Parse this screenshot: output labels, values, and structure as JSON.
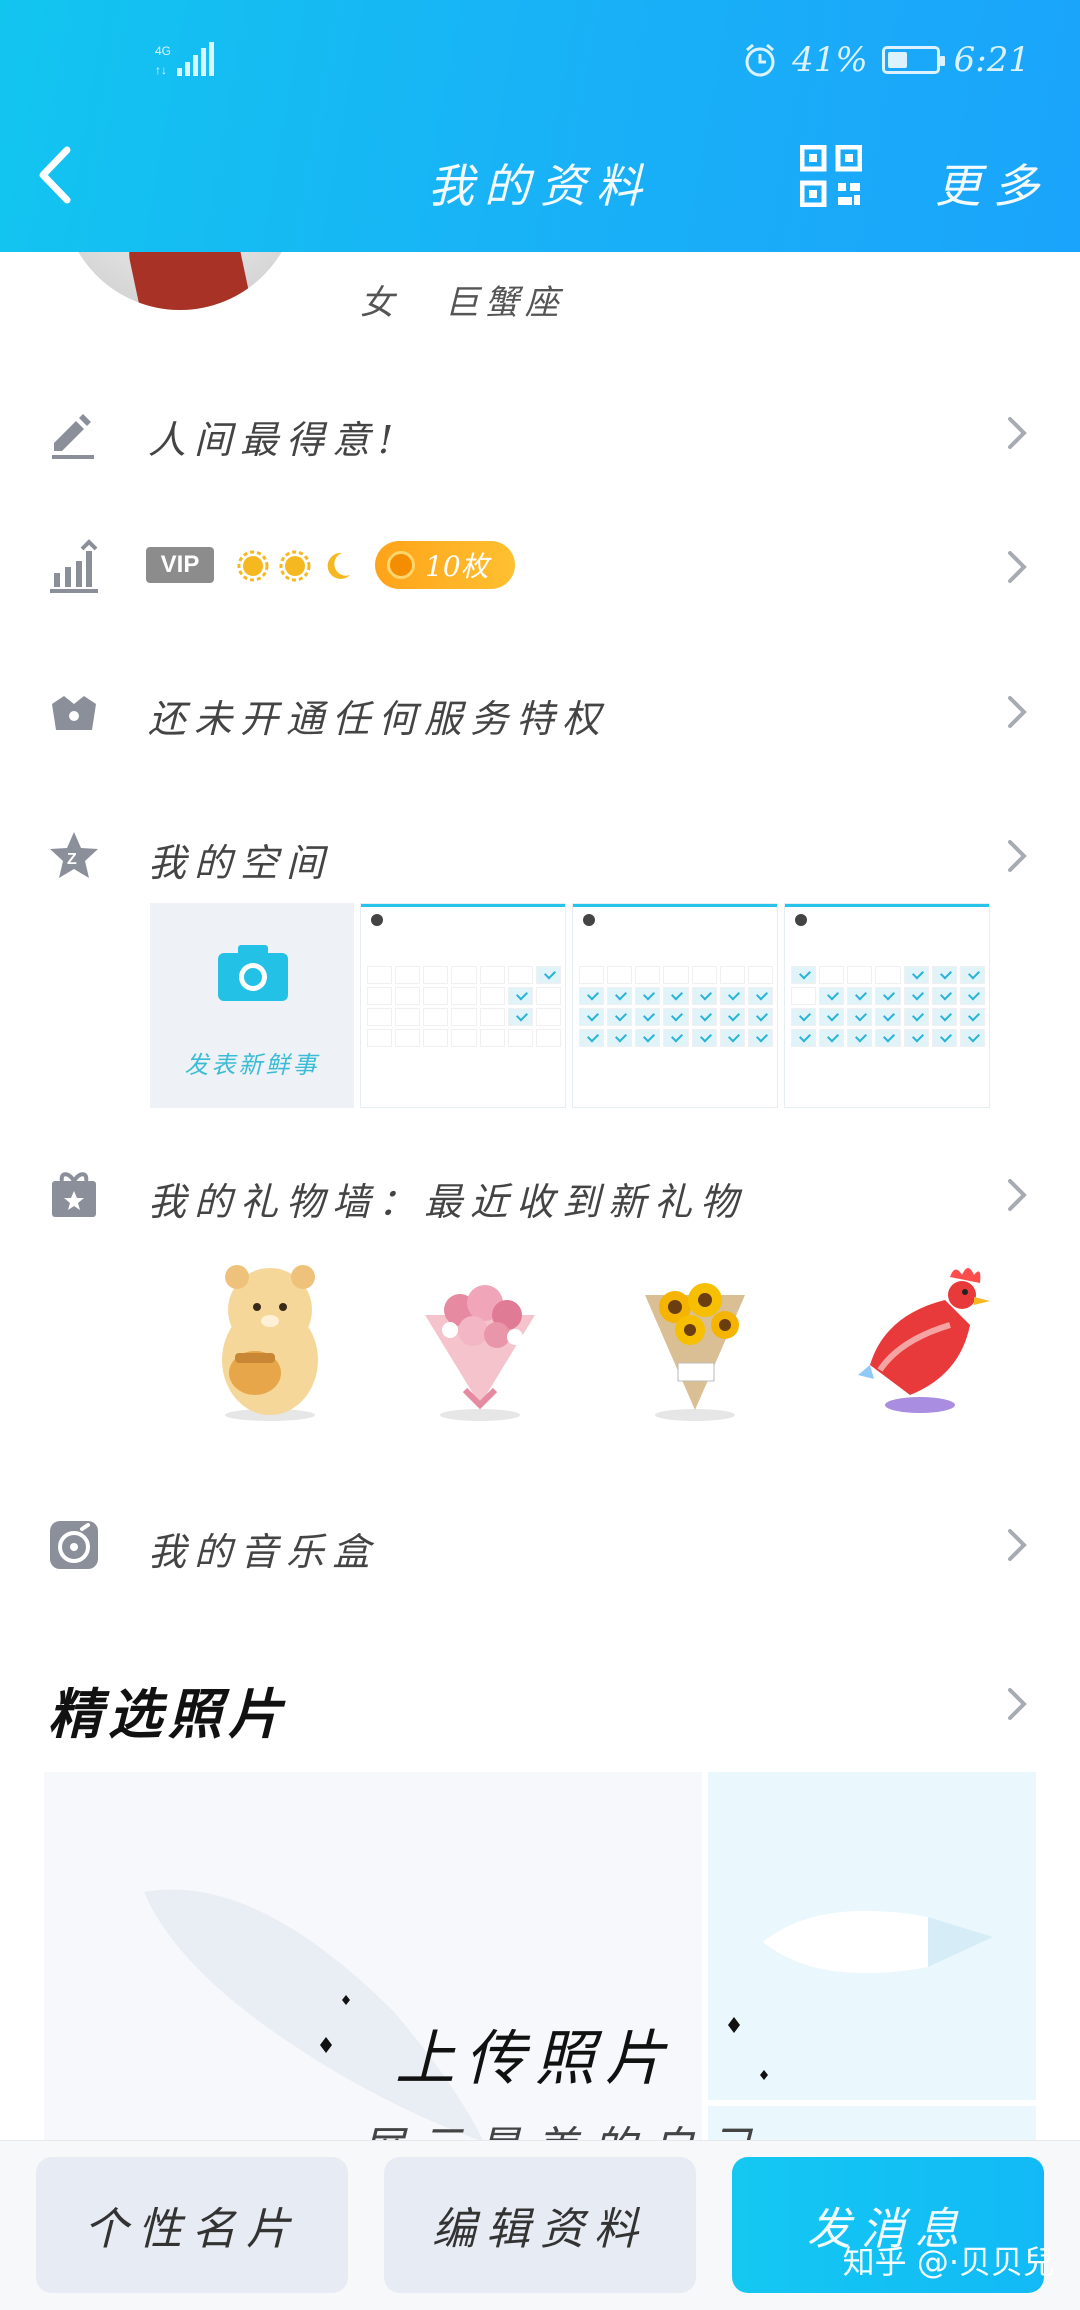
{
  "status_bar": {
    "network": "4G",
    "battery_text": "41%",
    "battery_level": 0.41,
    "time": "6:21"
  },
  "nav": {
    "title": "我的资料",
    "more_label": "更多"
  },
  "profile": {
    "gender": "女",
    "zodiac": "巨蟹座"
  },
  "rows": {
    "signature": "人间最得意!",
    "vip": {
      "badge": "VIP",
      "coin_count": "10枚"
    },
    "services": "还未开通任何服务特权",
    "space": {
      "label": "我的空间",
      "post_label": "发表新鲜事"
    },
    "gift_wall": "我的礼物墙：最近收到新礼物",
    "music_box": "我的音乐盒"
  },
  "gifts": [
    "bear-honey",
    "pink-bouquet",
    "sunflower-bouquet",
    "red-rooster"
  ],
  "featured": {
    "title": "精选照片",
    "upload_label": "上传照片",
    "upload_sub": "展示最美的自己"
  },
  "bottom_bar": {
    "card_label": "个性名片",
    "edit_label": "编辑资料",
    "message_label": "发消息"
  },
  "watermark": "知乎 @·贝贝兒",
  "colors": {
    "header": "#19b0f7",
    "accent": "#14c8f2",
    "icon_gray": "#8a8f99"
  }
}
